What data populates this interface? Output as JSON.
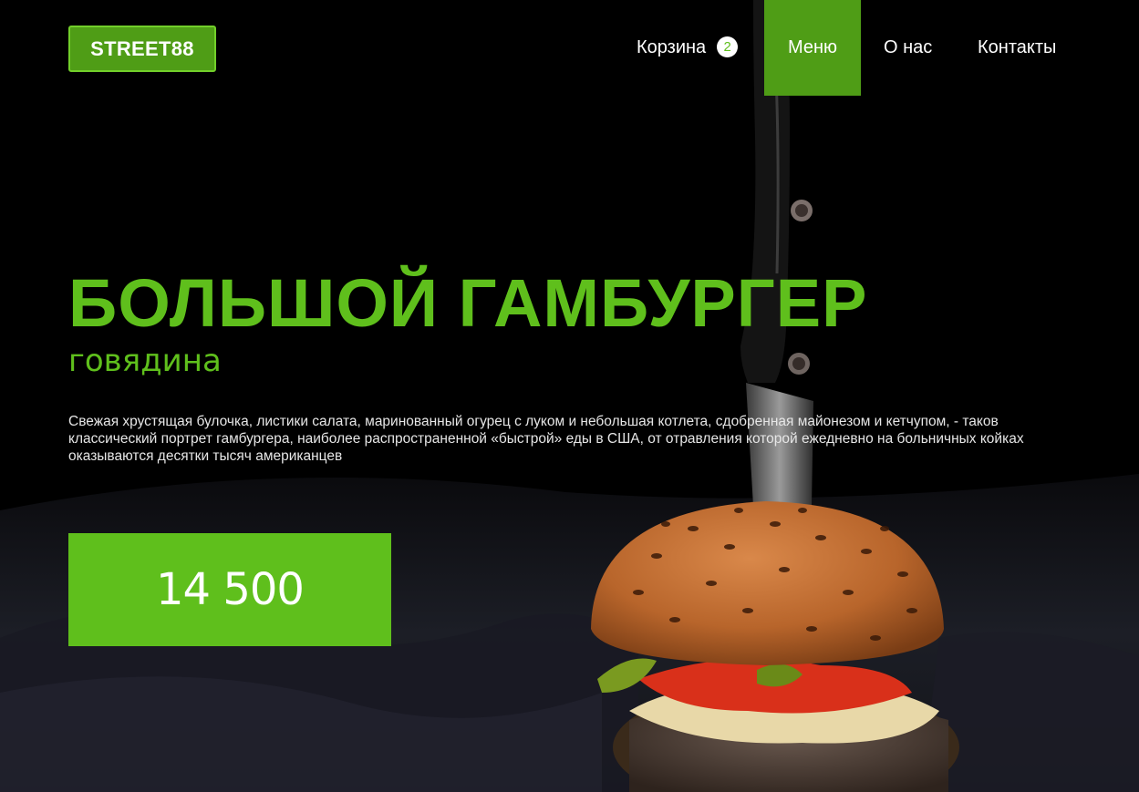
{
  "header": {
    "logo_text": "STREET88",
    "nav": {
      "cart_label": "Корзина",
      "cart_count": "2",
      "menu_label": "Меню",
      "about_label": "О нас",
      "contacts_label": "Контакты"
    }
  },
  "hero": {
    "title": "БОЛЬШОЙ ГАМБУРГЕР",
    "subtitle": "говядина",
    "description": "Свежая хрустящая булочка, листики салата, маринованный огурец с луком и небольшая котлета, сдобренная майонезом и кетчупом, - таков классический портрет гамбургера, наиболее распространенной «быстрой» еды в США, от отравления которой ежедневно на больничных койках оказываются десятки тысяч американцев",
    "price": "14 500"
  },
  "colors": {
    "accent": "#5fbf1c",
    "accent_dark": "#4f9d16",
    "background": "#000000"
  }
}
